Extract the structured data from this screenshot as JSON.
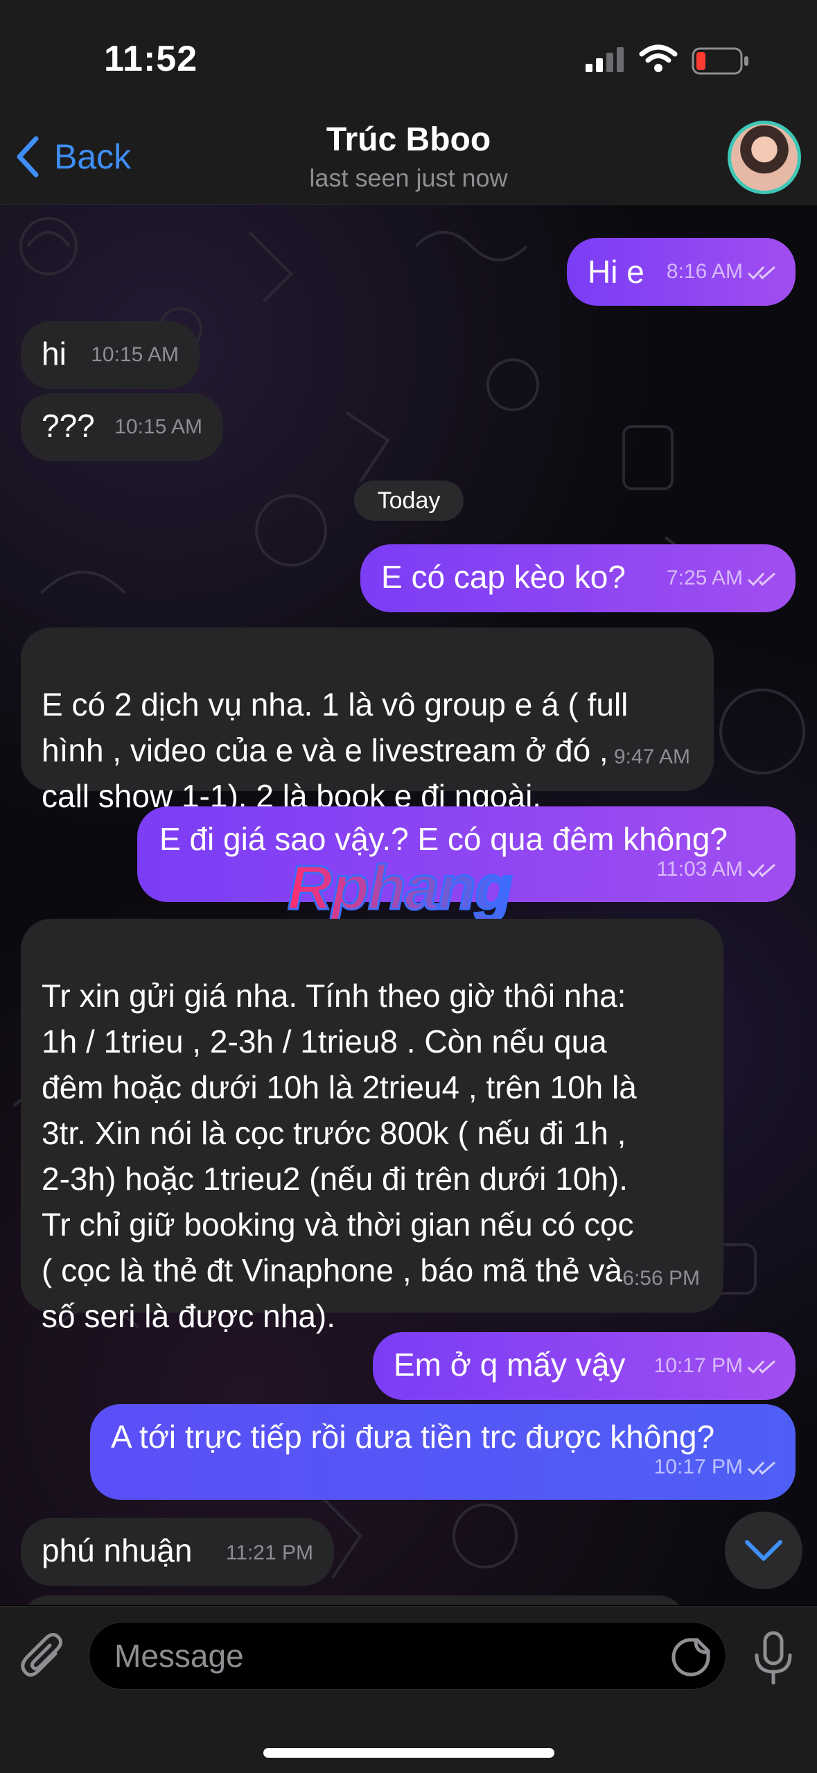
{
  "status_bar": {
    "time": "11:52"
  },
  "header": {
    "back_label": "Back",
    "title": "Trúc Bboo",
    "subtitle": "last seen just now"
  },
  "messages": [
    {
      "dir": "out",
      "text": "Hi e",
      "time": "8:16 AM"
    },
    {
      "dir": "in",
      "text": "hi",
      "time": "10:15 AM"
    },
    {
      "dir": "in",
      "text": "???",
      "time": "10:15 AM"
    },
    {
      "dir": "out",
      "text": "E có cap kèo ko?",
      "time": "7:25 AM"
    },
    {
      "dir": "in",
      "text": "E có 2 dịch vụ nha. 1 là vô group e á ( full\nhình , video của e và e livestream ở đó ,\ncall show 1-1). 2 là book e đi ngoài.",
      "time": "9:47 AM"
    },
    {
      "dir": "out",
      "text": "E đi giá sao vậy.? E có qua đêm không?",
      "time": "11:03 AM"
    },
    {
      "dir": "in",
      "text": "Tr xin gửi giá nha. Tính theo giờ thôi nha:\n1h / 1trieu , 2-3h / 1trieu8 . Còn nếu qua\nđêm hoặc dưới 10h là 2trieu4 , trên 10h là\n3tr. Xin nói là cọc trước 800k ( nếu đi 1h ,\n2-3h) hoặc 1trieu2 (nếu đi trên dưới 10h).\nTr chỉ giữ booking và thời gian nếu có cọc\n( cọc là thẻ đt Vinaphone , báo mã thẻ và\nsố seri là được nha).",
      "time": "6:56 PM"
    },
    {
      "dir": "out",
      "text": "Em ở q mấy vậy",
      "time": "10:17 PM"
    },
    {
      "dir": "out",
      "text": "A tới trực tiếp rồi đưa tiền trc được không?",
      "time": "10:17 PM"
    },
    {
      "dir": "in",
      "text": "phú nhuận",
      "time": "11:21 PM"
    }
  ],
  "date_separator": "Today",
  "watermark": "Rphang",
  "input": {
    "placeholder": "Message"
  },
  "icons": [
    "back-chevron-icon",
    "signal-icon",
    "wifi-icon",
    "battery-icon",
    "double-check-icon",
    "chevron-down-icon",
    "paperclip-icon",
    "sticker-icon",
    "microphone-icon"
  ],
  "colors": {
    "accent": "#3e8ff7",
    "outgoing": "#8b45f3",
    "outgoing_blue": "#5656f6",
    "incoming": "#262628",
    "battery_low": "#ff3b30"
  }
}
